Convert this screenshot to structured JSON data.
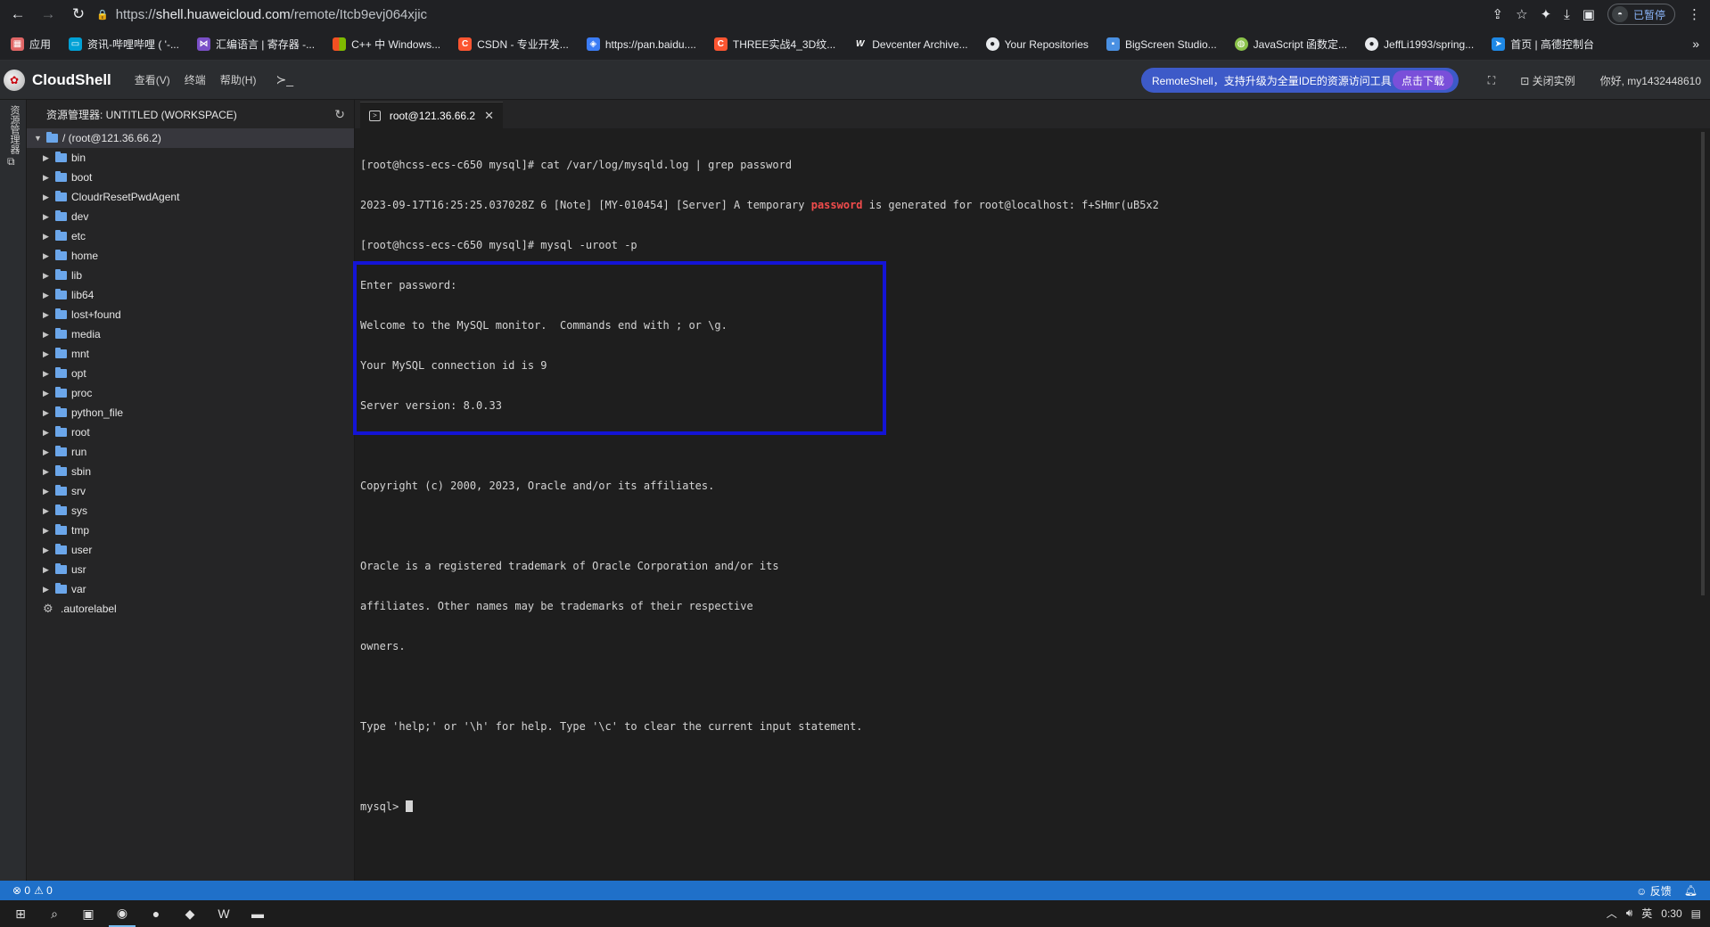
{
  "browser": {
    "url_prefix": "https://",
    "url_host": "shell.huaweicloud.com",
    "url_path": "/remote/Itcb9evj064xjic",
    "profile_status": "已暂停"
  },
  "bookmarks": [
    {
      "label": "应用",
      "icon": "apps-grid-icon",
      "color": "#e06666"
    },
    {
      "label": "资讯-哔哩哔哩 ( '-...",
      "icon": "bilibili-icon",
      "color": "#00a1d6"
    },
    {
      "label": "汇编语言 | 寄存器 -...",
      "icon": "visual-studio-icon",
      "color": "#7a4fc7"
    },
    {
      "label": "C++ 中 Windows...",
      "icon": "microsoft-icon",
      "color": "#f25022"
    },
    {
      "label": "CSDN - 专业开发...",
      "icon": "csdn-icon",
      "color": "#fc5531"
    },
    {
      "label": "https://pan.baidu....",
      "icon": "baidu-pan-icon",
      "color": "#3b7cf5"
    },
    {
      "label": "THREE实战4_3D纹...",
      "icon": "csdn-icon",
      "color": "#fc5531"
    },
    {
      "label": "Devcenter Archive...",
      "icon": "w-icon",
      "color": "#2b2d30"
    },
    {
      "label": "Your Repositories",
      "icon": "github-icon",
      "color": "#2b2d30"
    },
    {
      "label": "BigScreen Studio...",
      "icon": "bigscreen-icon",
      "color": "#4a90e2"
    },
    {
      "label": "JavaScript 函数定...",
      "icon": "globe-icon",
      "color": "#8bc34a"
    },
    {
      "label": "JeffLi1993/spring...",
      "icon": "github-icon",
      "color": "#2b2d30"
    },
    {
      "label": "首页 | 高德控制台",
      "icon": "amap-icon",
      "color": "#1e88e5"
    }
  ],
  "cloudshell": {
    "brand": "CloudShell",
    "menu": [
      "查看(V)",
      "终端",
      "帮助(H)"
    ],
    "remote_pill_text": "RemoteShell，支持升级为全量IDE的资源访问工具",
    "remote_pill_button": "点击下载",
    "close_instance": "关闭实例",
    "greeting": "你好, my1432448610"
  },
  "activity_bar": {
    "label": "资源管理器"
  },
  "explorer": {
    "title": "资源管理器: UNTITLED (WORKSPACE)",
    "root": "/ (root@121.36.66.2)",
    "folders": [
      "bin",
      "boot",
      "CloudrResetPwdAgent",
      "dev",
      "etc",
      "home",
      "lib",
      "lib64",
      "lost+found",
      "media",
      "mnt",
      "opt",
      "proc",
      "python_file",
      "root",
      "run",
      "sbin",
      "srv",
      "sys",
      "tmp",
      "user",
      "usr",
      "var"
    ],
    "files": [
      ".autorelabel"
    ]
  },
  "terminal": {
    "tab_title": "root@121.36.66.2",
    "lines": {
      "l1": "[root@hcss-ecs-c650 mysql]# cat /var/log/mysqld.log | grep password",
      "l2_before": "2023-09-17T16:25:25.037028Z 6 [Note] [MY-010454] [Server] A temporary ",
      "l2_highlight": "password",
      "l2_after": " is generated for root@localhost: f+SHmr(uB5x2",
      "l3": "[root@hcss-ecs-c650 mysql]# mysql -uroot -p",
      "l4": "Enter password:",
      "l5": "Welcome to the MySQL monitor.  Commands end with ; or \\g.",
      "l6": "Your MySQL connection id is 9",
      "l7": "Server version: 8.0.33",
      "l8": "Copyright (c) 2000, 2023, Oracle and/or its affiliates.",
      "l9": "Oracle is a registered trademark of Oracle Corporation and/or its",
      "l10": "affiliates. Other names may be trademarks of their respective",
      "l11": "owners.",
      "l12": "Type 'help;' or '\\h' for help. Type '\\c' to clear the current input statement.",
      "prompt": "mysql> "
    }
  },
  "status_bar": {
    "errors": "⊗ 0",
    "warnings": "⚠ 0",
    "feedback": "☺ 反馈"
  },
  "taskbar": {
    "ime": "英",
    "time": "0:30"
  },
  "colors": {
    "highlight_box": "#1414d6",
    "status_bar": "#1f70c9",
    "remote_pill": "#3d5ac8"
  }
}
